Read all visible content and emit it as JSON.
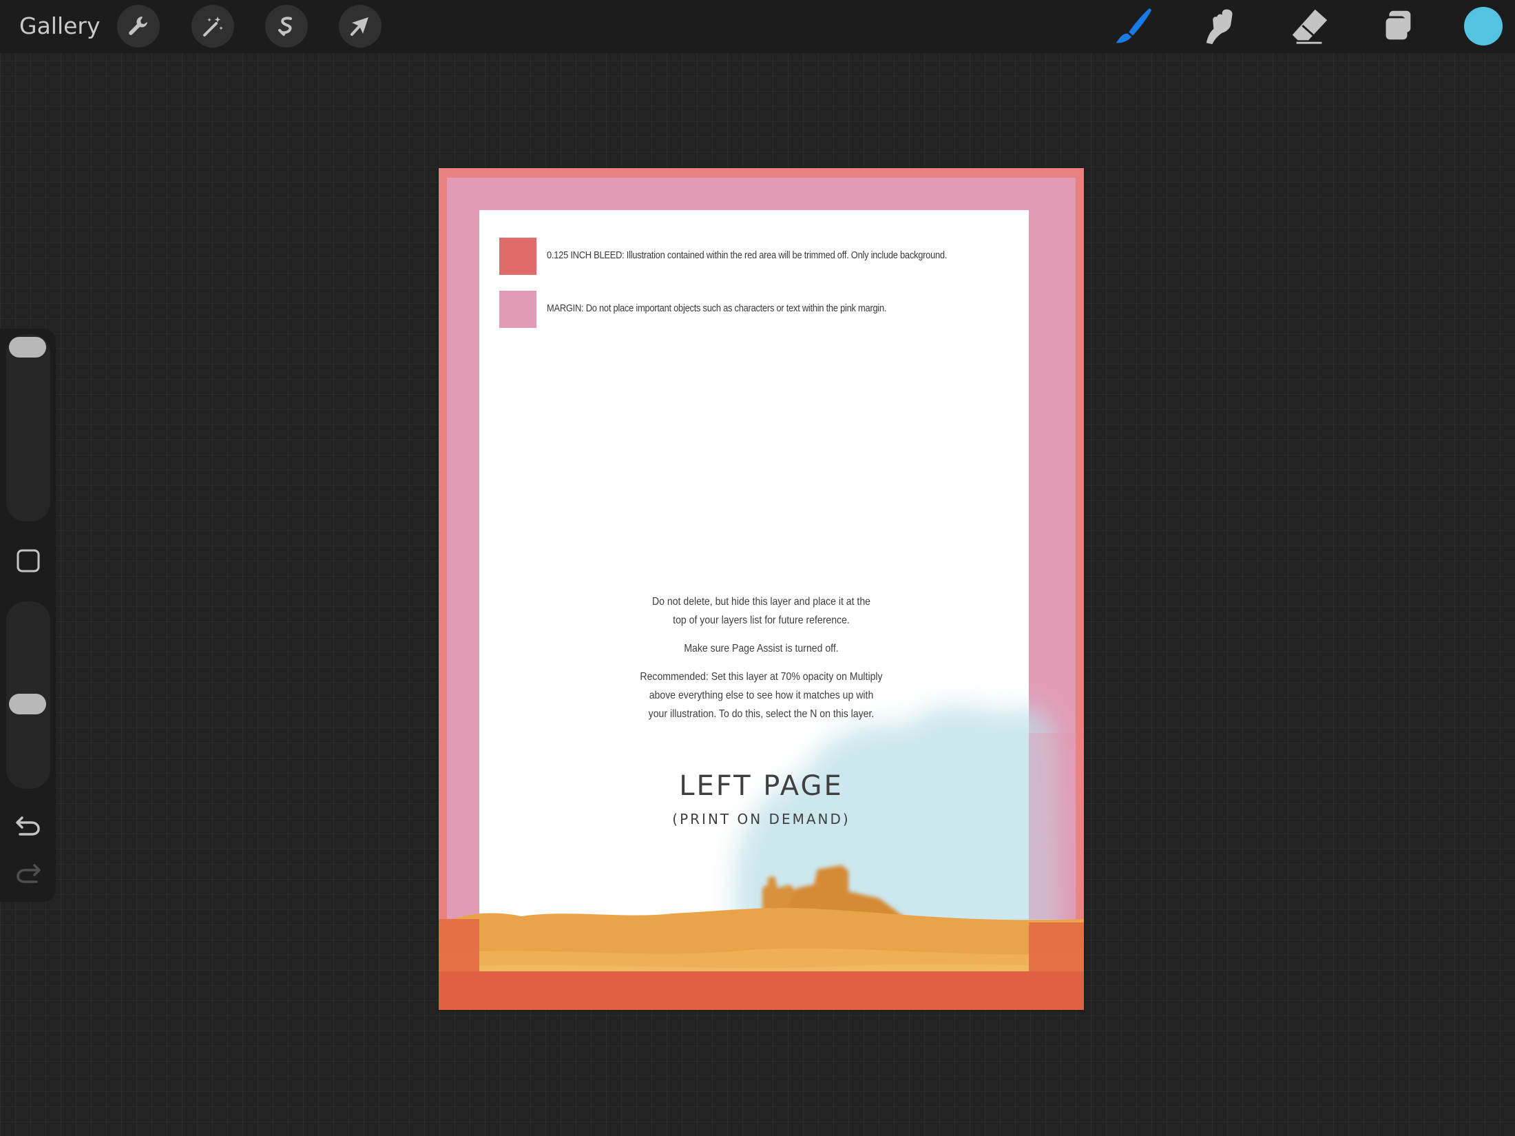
{
  "toolbar": {
    "gallery_label": "Gallery",
    "left_tools": [
      "wrench-icon",
      "magic-wand-icon",
      "selection-icon",
      "transform-arrow-icon"
    ],
    "right_tools": [
      "brush-icon",
      "smudge-icon",
      "eraser-icon",
      "layers-icon"
    ],
    "current_color": "#53c3e1",
    "active_tool_color": "#1a7ae6"
  },
  "sidebar": {
    "brush_size_level": 0.05,
    "opacity_level": 0.55
  },
  "document": {
    "bleed_color": "#e98181",
    "margin_color": "#e29bb6",
    "legend": [
      {
        "color": "#e06b6b",
        "text": "0.125 INCH BLEED: Illustration contained within the red area will be trimmed off. Only include background."
      },
      {
        "color": "#e29bb6",
        "text": "MARGIN: Do not place important objects such as characters or text within the pink margin."
      }
    ],
    "notes": [
      [
        "Do not delete, but hide this layer and place it at the",
        "top of your layers list for future reference."
      ],
      [
        "Make sure Page Assist is turned off."
      ],
      [
        "Recommended: Set this layer at 70% opacity on Multiply",
        "above everything else to see how it matches up with",
        "your illustration. To do this, select the N on this layer."
      ]
    ],
    "title": "LEFT PAGE",
    "subtitle": "(PRINT ON DEMAND)"
  }
}
